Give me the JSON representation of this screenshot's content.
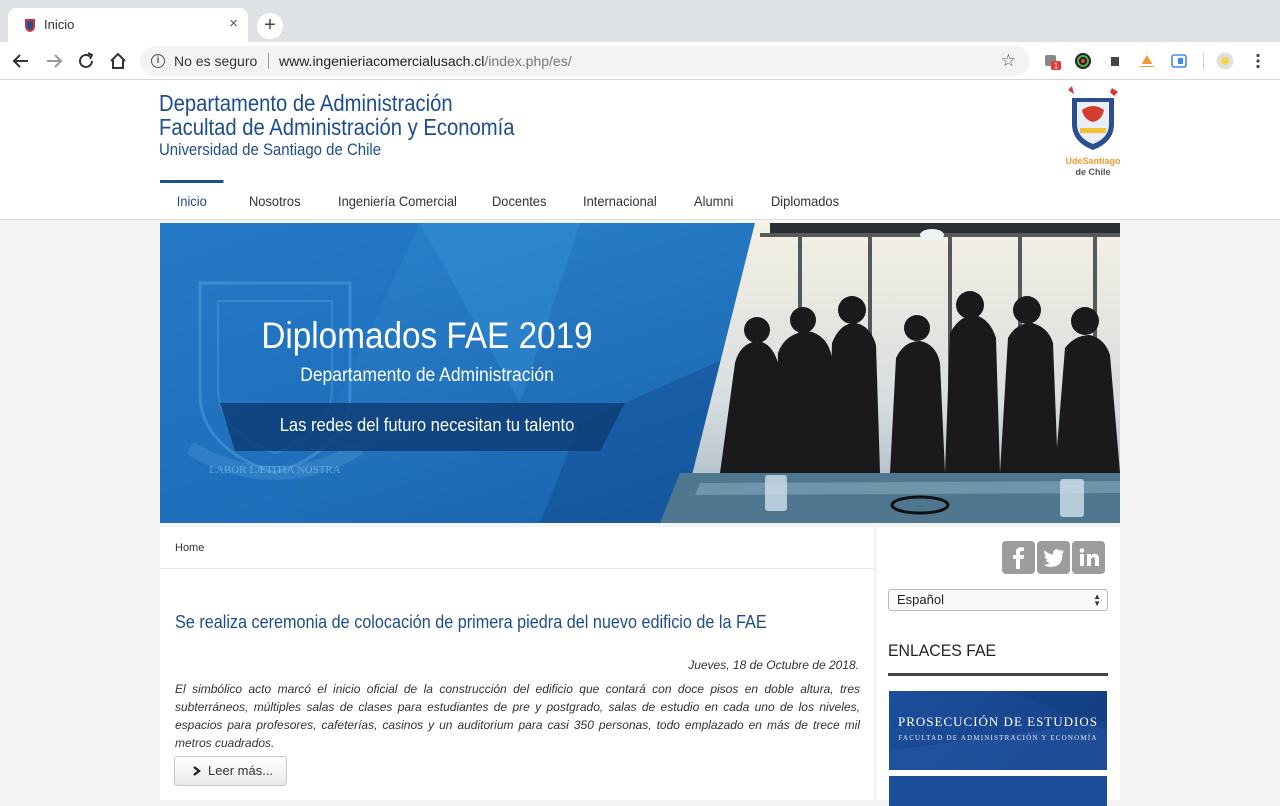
{
  "browser": {
    "tab_title": "Inicio",
    "tab_close": "×",
    "new_tab": "+",
    "security_label": "No es seguro",
    "url_host": "www.ingenieriacomercialusach.cl",
    "url_path": "/index.php/es/",
    "extension_badge": "1"
  },
  "header": {
    "line1": "Departamento de Administración",
    "line2": "Facultad de Administración y Economía",
    "line3": "Universidad de Santiago de Chile",
    "logo_text_a": "UdeSantiago",
    "logo_text_b": "de Chile"
  },
  "nav": {
    "items": [
      "Inicio",
      "Nosotros",
      "Ingeniería Comercial",
      "Docentes",
      "Internacional",
      "Alumni",
      "Diplomados"
    ],
    "active": "Inicio"
  },
  "banner": {
    "title": "Diplomados FAE 2019",
    "subtitle": "Departamento de Administración",
    "tagline": "Las redes del futuro necesitan tu talento",
    "crest_motto": "LABOR LÆTITIA NOSTRA"
  },
  "article": {
    "breadcrumb": "Home",
    "title": "Se realiza ceremonia de colocación de primera piedra del nuevo edificio de la FAE",
    "date": "Jueves, 18 de Octubre de 2018.",
    "body": "El simbólico acto marcó el inicio oficial de la construcción del edificio que contará con doce pisos en doble altura, tres subterráneos, múltiples salas de clases para estudiantes de pre y postgrado, salas de estudio en cada uno de los niveles, espacios para profesores, cafeterías, casinos y un auditorium para casi 350 personas, todo emplazado en más de trece mil metros cuadrados.",
    "read_more": "Leer más..."
  },
  "sidebar": {
    "social_icons": [
      "facebook-icon",
      "twitter-icon",
      "linkedin-icon"
    ],
    "language": "Español",
    "links_heading": "ENLACES FAE",
    "link1_title": "PROSECUCIÓN DE ESTUDIOS",
    "link1_subtitle": "FACULTAD DE ADMINISTRACIÓN Y ECONOMÍA"
  },
  "colors": {
    "brand_blue": "#1d4e8f",
    "banner_blue": "#1f67b1",
    "social_gray": "#9c9c9c"
  }
}
